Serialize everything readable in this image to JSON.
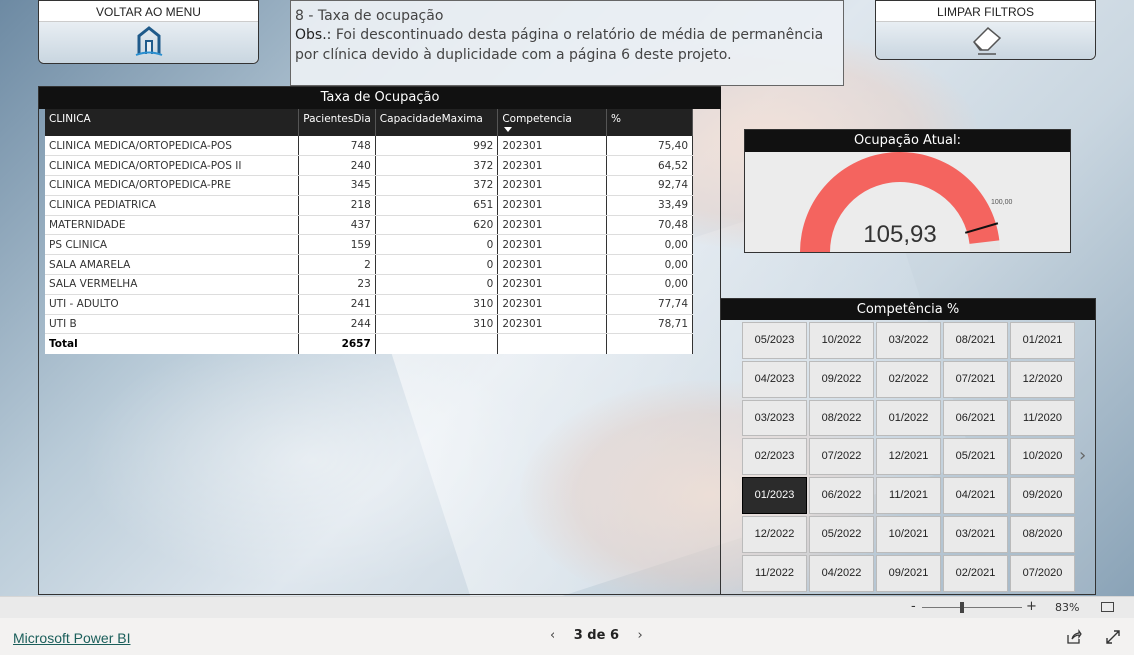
{
  "header": {
    "menu_button": "VOLTAR AO MENU",
    "clear_button": "LIMPAR FILTROS",
    "info_title": "8 - Taxa de ocupação",
    "info_obs_label": "Obs.:",
    "info_obs_text": " Foi descontinuado desta página o relatório de média de permanência por clínica devido à duplicidade com a página 6 deste projeto."
  },
  "table": {
    "title": "Taxa de Ocupação",
    "columns": [
      "CLINICA",
      "PacientesDia",
      "CapacidadeMaxima",
      "Competencia",
      "%"
    ],
    "rows": [
      [
        "CLINICA MEDICA/ORTOPEDICA-POS",
        "748",
        "992",
        "202301",
        "75,40"
      ],
      [
        "CLINICA MEDICA/ORTOPEDICA-POS II",
        "240",
        "372",
        "202301",
        "64,52"
      ],
      [
        "CLINICA MEDICA/ORTOPEDICA-PRE",
        "345",
        "372",
        "202301",
        "92,74"
      ],
      [
        "CLINICA PEDIATRICA",
        "218",
        "651",
        "202301",
        "33,49"
      ],
      [
        "MATERNIDADE",
        "437",
        "620",
        "202301",
        "70,48"
      ],
      [
        "PS CLINICA",
        "159",
        "0",
        "202301",
        "0,00"
      ],
      [
        "SALA AMARELA",
        "2",
        "0",
        "202301",
        "0,00"
      ],
      [
        "SALA VERMELHA",
        "23",
        "0",
        "202301",
        "0,00"
      ],
      [
        "UTI - ADULTO",
        "241",
        "310",
        "202301",
        "77,74"
      ],
      [
        "UTI B",
        "244",
        "310",
        "202301",
        "78,71"
      ]
    ],
    "total": [
      "Total",
      "2657",
      "",
      "",
      ""
    ]
  },
  "gauge": {
    "title": "Ocupação Atual:",
    "value": "105,93",
    "value_num": 105.93,
    "target_label": "100,00",
    "target_num": 100,
    "max": 110,
    "fill_color": "#f4645f"
  },
  "slicer": {
    "title": "Competência %",
    "items": [
      "05/2023",
      "10/2022",
      "03/2022",
      "08/2021",
      "01/2021",
      "04/2023",
      "09/2022",
      "02/2022",
      "07/2021",
      "12/2020",
      "03/2023",
      "08/2022",
      "01/2022",
      "06/2021",
      "11/2020",
      "02/2023",
      "07/2022",
      "12/2021",
      "05/2021",
      "10/2020",
      "01/2023",
      "06/2022",
      "11/2021",
      "04/2021",
      "09/2020",
      "12/2022",
      "05/2022",
      "10/2021",
      "03/2021",
      "08/2020",
      "11/2022",
      "04/2022",
      "09/2021",
      "02/2021",
      "07/2020"
    ],
    "selected": "01/2023"
  },
  "zoom": {
    "minus": "-",
    "plus": "+",
    "percent": "83%"
  },
  "footer": {
    "brand": "Microsoft Power BI",
    "page_indicator": "3 de 6",
    "prev": "‹",
    "next": "›"
  }
}
